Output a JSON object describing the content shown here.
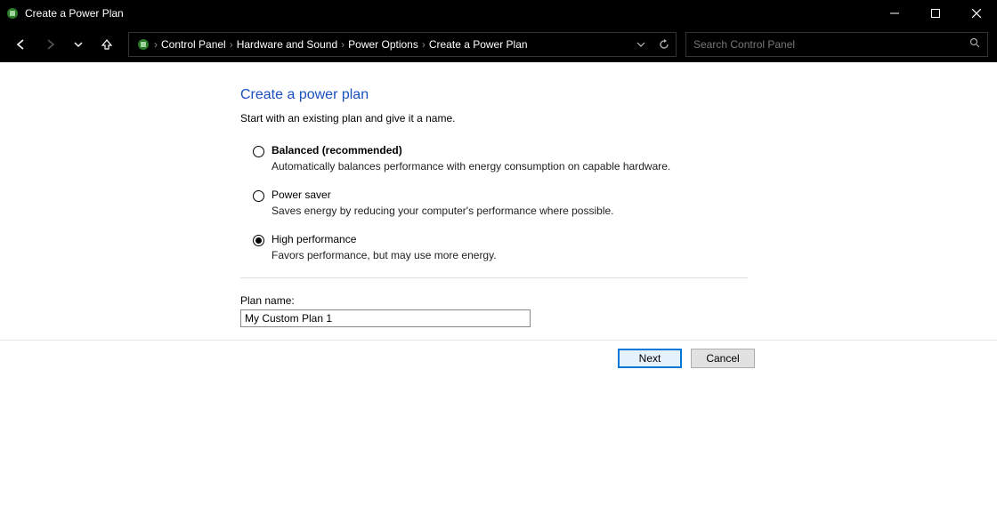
{
  "window": {
    "title": "Create a Power Plan"
  },
  "breadcrumb": {
    "seg0": "Control Panel",
    "seg1": "Hardware and Sound",
    "seg2": "Power Options",
    "seg3": "Create a Power Plan"
  },
  "search": {
    "placeholder": "Search Control Panel"
  },
  "page": {
    "heading": "Create a power plan",
    "subheading": "Start with an existing plan and give it a name."
  },
  "plans": [
    {
      "id": "balanced",
      "title": "Balanced (recommended)",
      "desc": "Automatically balances performance with energy consumption on capable hardware.",
      "bold": true,
      "selected": false
    },
    {
      "id": "powersaver",
      "title": "Power saver",
      "desc": "Saves energy by reducing your computer's performance where possible.",
      "bold": false,
      "selected": false
    },
    {
      "id": "highperf",
      "title": "High performance",
      "desc": "Favors performance, but may use more energy.",
      "bold": false,
      "selected": true
    }
  ],
  "name": {
    "label": "Plan name:",
    "value": "My Custom Plan 1"
  },
  "buttons": {
    "next": "Next",
    "cancel": "Cancel"
  }
}
